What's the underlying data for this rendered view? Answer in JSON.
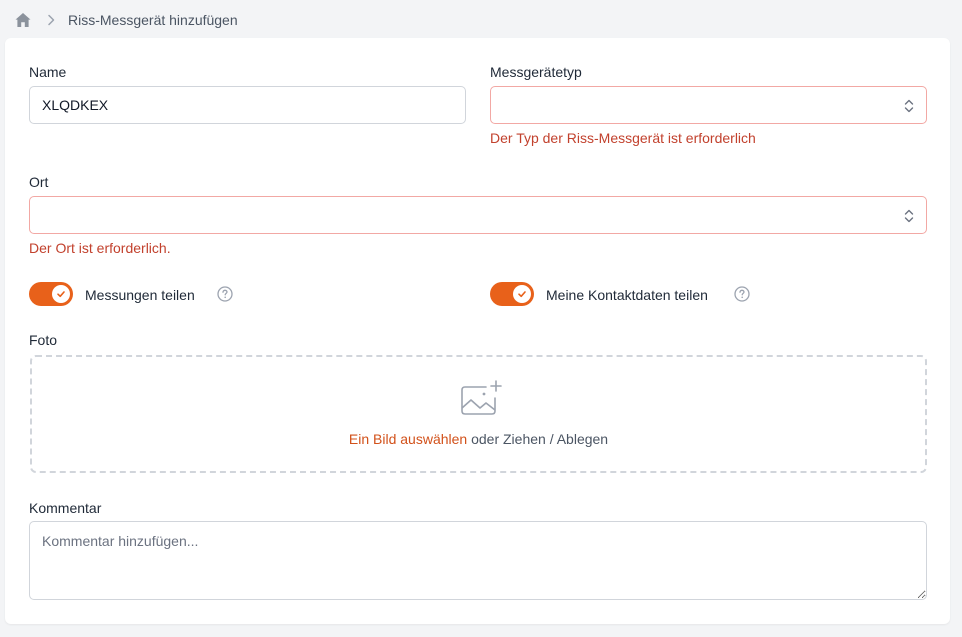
{
  "breadcrumb": {
    "title": "Riss-Messgerät hinzufügen"
  },
  "form": {
    "name": {
      "label": "Name",
      "value": "XLQDKEX"
    },
    "device_type": {
      "label": "Messgerätetyp",
      "value": "",
      "error": "Der Typ der Riss-Messgerät ist erforderlich"
    },
    "location": {
      "label": "Ort",
      "value": "",
      "error": "Der Ort ist erforderlich."
    },
    "share_measurements": {
      "label": "Messungen teilen",
      "checked": true
    },
    "share_contact": {
      "label": "Meine Kontaktdaten teilen",
      "checked": true
    },
    "photo": {
      "label": "Foto",
      "link_text": "Ein Bild auswählen",
      "rest_text": " oder Ziehen / Ablegen"
    },
    "comment": {
      "label": "Kommentar",
      "placeholder": "Kommentar hinzufügen..."
    }
  },
  "colors": {
    "accent": "#e8611a",
    "error": "#c2412d",
    "error_border": "#f2a8a4"
  },
  "icons": {
    "home": "home-icon",
    "separator": "chevron-right-icon",
    "select": "chevron-up-down-icon",
    "help": "question-circle-icon",
    "check": "check-icon",
    "upload": "image-plus-icon"
  }
}
